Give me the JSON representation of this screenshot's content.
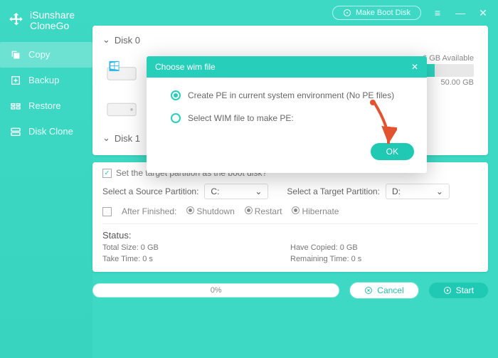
{
  "brand": {
    "line1": "iSunshare",
    "line2": "CloneGo"
  },
  "topbar": {
    "make_boot": "Make Boot Disk"
  },
  "nav": {
    "copy": "Copy",
    "backup": "Backup",
    "restore": "Restore",
    "diskclone": "Disk Clone"
  },
  "disks": {
    "d0": {
      "label": "Disk 0",
      "avail": "6 GB Available",
      "cap": "50.00 GB"
    },
    "d1": {
      "label": "Disk 1"
    }
  },
  "target": {
    "checkbox_label": "Set the target partition as the boot disk?",
    "source_label": "Select a Source Partition:",
    "source_value": "C:",
    "target_label": "Select a Target Partition:",
    "target_value": "D:",
    "after_label": "After Finished:",
    "shutdown": "Shutdown",
    "restart": "Restart",
    "hibernate": "Hibernate"
  },
  "status": {
    "title": "Status:",
    "total": "Total Size: 0 GB",
    "copied": "Have Copied: 0 GB",
    "take": "Take Time: 0 s",
    "remain": "Remaining Time: 0 s"
  },
  "footer": {
    "progress": "0%",
    "cancel": "Cancel",
    "start": "Start"
  },
  "modal": {
    "title": "Choose wim file",
    "opt1": "Create PE in current system environment (No PE files)",
    "opt2": "Select WIM file to make PE:",
    "ok": "OK"
  }
}
